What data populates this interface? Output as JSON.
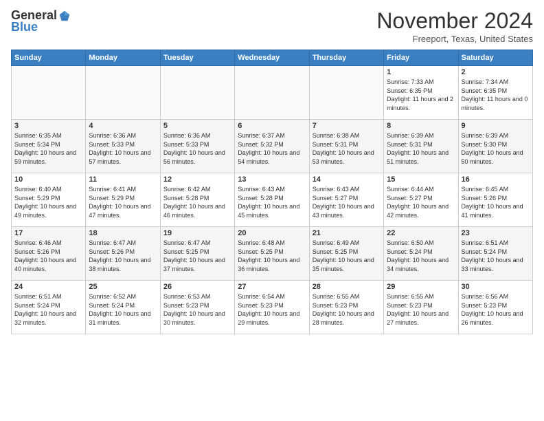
{
  "logo": {
    "general": "General",
    "blue": "Blue"
  },
  "header": {
    "month": "November 2024",
    "location": "Freeport, Texas, United States"
  },
  "weekdays": [
    "Sunday",
    "Monday",
    "Tuesday",
    "Wednesday",
    "Thursday",
    "Friday",
    "Saturday"
  ],
  "weeks": [
    [
      {
        "day": "",
        "info": ""
      },
      {
        "day": "",
        "info": ""
      },
      {
        "day": "",
        "info": ""
      },
      {
        "day": "",
        "info": ""
      },
      {
        "day": "",
        "info": ""
      },
      {
        "day": "1",
        "info": "Sunrise: 7:33 AM\nSunset: 6:35 PM\nDaylight: 11 hours and 2 minutes."
      },
      {
        "day": "2",
        "info": "Sunrise: 7:34 AM\nSunset: 6:35 PM\nDaylight: 11 hours and 0 minutes."
      }
    ],
    [
      {
        "day": "3",
        "info": "Sunrise: 6:35 AM\nSunset: 5:34 PM\nDaylight: 10 hours and 59 minutes."
      },
      {
        "day": "4",
        "info": "Sunrise: 6:36 AM\nSunset: 5:33 PM\nDaylight: 10 hours and 57 minutes."
      },
      {
        "day": "5",
        "info": "Sunrise: 6:36 AM\nSunset: 5:33 PM\nDaylight: 10 hours and 56 minutes."
      },
      {
        "day": "6",
        "info": "Sunrise: 6:37 AM\nSunset: 5:32 PM\nDaylight: 10 hours and 54 minutes."
      },
      {
        "day": "7",
        "info": "Sunrise: 6:38 AM\nSunset: 5:31 PM\nDaylight: 10 hours and 53 minutes."
      },
      {
        "day": "8",
        "info": "Sunrise: 6:39 AM\nSunset: 5:31 PM\nDaylight: 10 hours and 51 minutes."
      },
      {
        "day": "9",
        "info": "Sunrise: 6:39 AM\nSunset: 5:30 PM\nDaylight: 10 hours and 50 minutes."
      }
    ],
    [
      {
        "day": "10",
        "info": "Sunrise: 6:40 AM\nSunset: 5:29 PM\nDaylight: 10 hours and 49 minutes."
      },
      {
        "day": "11",
        "info": "Sunrise: 6:41 AM\nSunset: 5:29 PM\nDaylight: 10 hours and 47 minutes."
      },
      {
        "day": "12",
        "info": "Sunrise: 6:42 AM\nSunset: 5:28 PM\nDaylight: 10 hours and 46 minutes."
      },
      {
        "day": "13",
        "info": "Sunrise: 6:43 AM\nSunset: 5:28 PM\nDaylight: 10 hours and 45 minutes."
      },
      {
        "day": "14",
        "info": "Sunrise: 6:43 AM\nSunset: 5:27 PM\nDaylight: 10 hours and 43 minutes."
      },
      {
        "day": "15",
        "info": "Sunrise: 6:44 AM\nSunset: 5:27 PM\nDaylight: 10 hours and 42 minutes."
      },
      {
        "day": "16",
        "info": "Sunrise: 6:45 AM\nSunset: 5:26 PM\nDaylight: 10 hours and 41 minutes."
      }
    ],
    [
      {
        "day": "17",
        "info": "Sunrise: 6:46 AM\nSunset: 5:26 PM\nDaylight: 10 hours and 40 minutes."
      },
      {
        "day": "18",
        "info": "Sunrise: 6:47 AM\nSunset: 5:26 PM\nDaylight: 10 hours and 38 minutes."
      },
      {
        "day": "19",
        "info": "Sunrise: 6:47 AM\nSunset: 5:25 PM\nDaylight: 10 hours and 37 minutes."
      },
      {
        "day": "20",
        "info": "Sunrise: 6:48 AM\nSunset: 5:25 PM\nDaylight: 10 hours and 36 minutes."
      },
      {
        "day": "21",
        "info": "Sunrise: 6:49 AM\nSunset: 5:25 PM\nDaylight: 10 hours and 35 minutes."
      },
      {
        "day": "22",
        "info": "Sunrise: 6:50 AM\nSunset: 5:24 PM\nDaylight: 10 hours and 34 minutes."
      },
      {
        "day": "23",
        "info": "Sunrise: 6:51 AM\nSunset: 5:24 PM\nDaylight: 10 hours and 33 minutes."
      }
    ],
    [
      {
        "day": "24",
        "info": "Sunrise: 6:51 AM\nSunset: 5:24 PM\nDaylight: 10 hours and 32 minutes."
      },
      {
        "day": "25",
        "info": "Sunrise: 6:52 AM\nSunset: 5:24 PM\nDaylight: 10 hours and 31 minutes."
      },
      {
        "day": "26",
        "info": "Sunrise: 6:53 AM\nSunset: 5:23 PM\nDaylight: 10 hours and 30 minutes."
      },
      {
        "day": "27",
        "info": "Sunrise: 6:54 AM\nSunset: 5:23 PM\nDaylight: 10 hours and 29 minutes."
      },
      {
        "day": "28",
        "info": "Sunrise: 6:55 AM\nSunset: 5:23 PM\nDaylight: 10 hours and 28 minutes."
      },
      {
        "day": "29",
        "info": "Sunrise: 6:55 AM\nSunset: 5:23 PM\nDaylight: 10 hours and 27 minutes."
      },
      {
        "day": "30",
        "info": "Sunrise: 6:56 AM\nSunset: 5:23 PM\nDaylight: 10 hours and 26 minutes."
      }
    ]
  ]
}
